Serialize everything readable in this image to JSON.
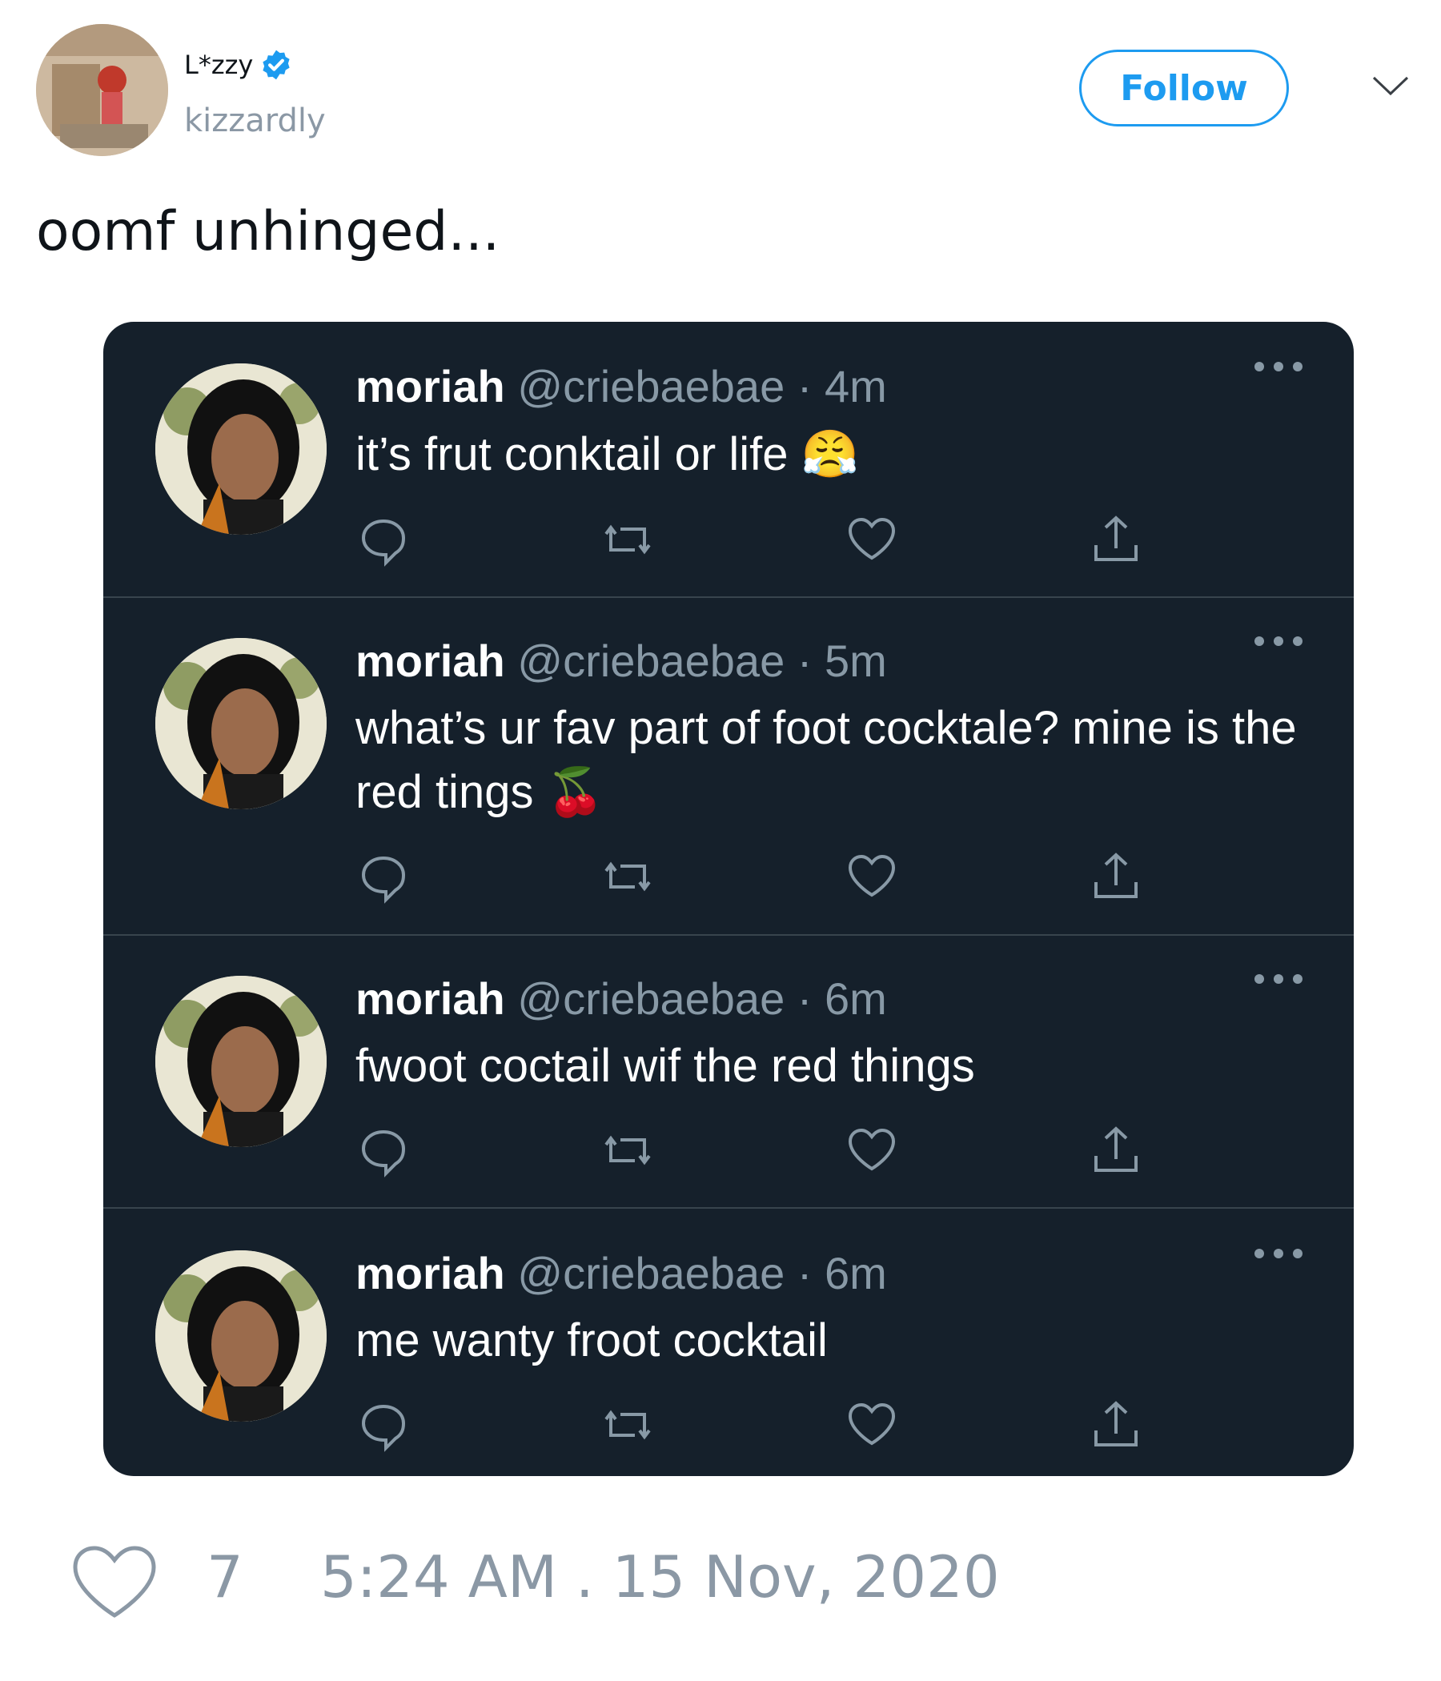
{
  "header": {
    "display_name": "L*zzy",
    "handle": "kizzardly",
    "follow_label": "Follow"
  },
  "tweet": {
    "text": "oomf unhinged..."
  },
  "embedded": {
    "tweets": [
      {
        "name": "moriah",
        "handle": "@criebaebae",
        "time": "4m",
        "text": "it’s frut conktail or life 😤"
      },
      {
        "name": "moriah",
        "handle": "@criebaebae",
        "time": "5m",
        "text": "what’s ur fav part of foot cocktale? mine is the red tings 🍒"
      },
      {
        "name": "moriah",
        "handle": "@criebaebae",
        "time": "6m",
        "text": "fwoot coctail wif the red things"
      },
      {
        "name": "moriah",
        "handle": "@criebaebae",
        "time": "6m",
        "text": "me wanty froot cocktail"
      }
    ]
  },
  "footer": {
    "like_count": "7",
    "timestamp": "5:24 AM . 15 Nov, 2020"
  },
  "colors": {
    "accent": "#1d9bf0",
    "dark_bg": "#15202b",
    "muted": "#8b98a5"
  }
}
